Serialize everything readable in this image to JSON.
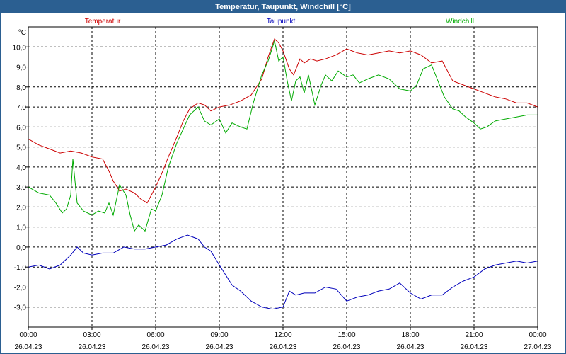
{
  "title": "Temperatur, Taupunkt, Windchill [°C]",
  "chart_data": {
    "type": "line",
    "title": "Temperatur, Taupunkt, Windchill [°C]",
    "ylabel": "°C",
    "ylim": [
      -4,
      11
    ],
    "xlim": [
      0,
      24
    ],
    "grid": true,
    "legend_placement": "top",
    "y_ticks": [
      {
        "value": 10,
        "label": "10,0"
      },
      {
        "value": 9,
        "label": "9,0"
      },
      {
        "value": 8,
        "label": "8,0"
      },
      {
        "value": 7,
        "label": "7,0"
      },
      {
        "value": 6,
        "label": "6,0"
      },
      {
        "value": 5,
        "label": "5,0"
      },
      {
        "value": 4,
        "label": "4,0"
      },
      {
        "value": 3,
        "label": "3,0"
      },
      {
        "value": 2,
        "label": "2,0"
      },
      {
        "value": 1,
        "label": "1,0"
      },
      {
        "value": 0,
        "label": "0,0"
      },
      {
        "value": -1,
        "label": "-1,0"
      },
      {
        "value": -2,
        "label": "-2,0"
      },
      {
        "value": -3,
        "label": "-3,0"
      }
    ],
    "x_ticks": [
      {
        "value": 0,
        "time": "00:00",
        "date": "26.04.23"
      },
      {
        "value": 3,
        "time": "03:00",
        "date": "26.04.23"
      },
      {
        "value": 6,
        "time": "06:00",
        "date": "26.04.23"
      },
      {
        "value": 9,
        "time": "09:00",
        "date": "26.04.23"
      },
      {
        "value": 12,
        "time": "12:00",
        "date": "26.04.23"
      },
      {
        "value": 15,
        "time": "15:00",
        "date": "26.04.23"
      },
      {
        "value": 18,
        "time": "18:00",
        "date": "26.04.23"
      },
      {
        "value": 21,
        "time": "21:00",
        "date": "26.04.23"
      },
      {
        "value": 24,
        "time": "00:00",
        "date": "27.04.23"
      }
    ],
    "series": [
      {
        "name": "Temperatur",
        "color": "#cc0000",
        "x": [
          0,
          0.5,
          1,
          1.5,
          2,
          2.5,
          3,
          3.5,
          3.8,
          4,
          4.3,
          4.6,
          5,
          5.3,
          5.6,
          6,
          6.3,
          6.6,
          7,
          7.3,
          7.6,
          8,
          8.3,
          8.6,
          9,
          9.5,
          10,
          10.5,
          11,
          11.3,
          11.6,
          11.8,
          12,
          12.3,
          12.5,
          12.8,
          13,
          13.3,
          13.6,
          14,
          14.5,
          15,
          15.5,
          16,
          16.5,
          17,
          17.5,
          18,
          18.5,
          19,
          19.5,
          20,
          20.5,
          21,
          21.5,
          22,
          22.5,
          23,
          23.5,
          24
        ],
        "values": [
          5.4,
          5.1,
          4.9,
          4.7,
          4.8,
          4.7,
          4.5,
          4.4,
          3.8,
          3.3,
          2.8,
          2.9,
          2.7,
          2.4,
          2.2,
          3,
          3.7,
          4.5,
          5.5,
          6.3,
          6.9,
          7.2,
          7.1,
          6.8,
          7,
          7.1,
          7.3,
          7.6,
          8.4,
          9.5,
          10.4,
          10.2,
          9.8,
          8.9,
          8.6,
          9.4,
          9.2,
          9.4,
          9.3,
          9.4,
          9.6,
          9.9,
          9.7,
          9.6,
          9.7,
          9.8,
          9.7,
          9.8,
          9.6,
          9.2,
          9.3,
          8.3,
          8.1,
          7.9,
          7.7,
          7.5,
          7.4,
          7.2,
          7.2,
          7
        ]
      },
      {
        "name": "Taupunkt",
        "color": "#0000bb",
        "x": [
          0,
          0.5,
          1,
          1.5,
          2,
          2.3,
          2.6,
          3,
          3.5,
          4,
          4.5,
          5,
          5.5,
          6,
          6.5,
          7,
          7.5,
          8,
          8.3,
          8.6,
          9,
          9.3,
          9.6,
          10,
          10.5,
          11,
          11.5,
          12,
          12.3,
          12.6,
          13,
          13.5,
          14,
          14.5,
          15,
          15.5,
          16,
          16.5,
          17,
          17.5,
          18,
          18.5,
          19,
          19.5,
          20,
          20.5,
          21,
          21.5,
          22,
          22.5,
          23,
          23.5,
          24
        ],
        "values": [
          -1,
          -0.9,
          -1.1,
          -0.9,
          -0.4,
          0,
          -0.3,
          -0.4,
          -0.3,
          -0.3,
          0,
          -0.1,
          -0.1,
          0,
          0.1,
          0.4,
          0.6,
          0.4,
          0,
          -0.2,
          -0.9,
          -1.4,
          -1.9,
          -2.2,
          -2.7,
          -3,
          -3.1,
          -3,
          -2.2,
          -2.4,
          -2.3,
          -2.3,
          -2,
          -2.1,
          -2.7,
          -2.5,
          -2.4,
          -2.2,
          -2.1,
          -1.8,
          -2.3,
          -2.6,
          -2.4,
          -2.4,
          -2,
          -1.7,
          -1.5,
          -1.1,
          -0.9,
          -0.8,
          -0.7,
          -0.8,
          -0.7
        ]
      },
      {
        "name": "Windchill",
        "color": "#00aa00",
        "x": [
          0,
          0.5,
          1,
          1.3,
          1.6,
          1.8,
          2,
          2.1,
          2.3,
          2.6,
          3,
          3.3,
          3.6,
          3.8,
          4,
          4.3,
          4.6,
          4.8,
          5,
          5.2,
          5.5,
          5.8,
          6,
          6.3,
          6.6,
          7,
          7.3,
          7.6,
          8,
          8.3,
          8.6,
          9,
          9.3,
          9.6,
          10,
          10.3,
          10.6,
          11,
          11.3,
          11.6,
          11.8,
          12,
          12.2,
          12.4,
          12.6,
          12.8,
          13,
          13.2,
          13.5,
          13.8,
          14,
          14.3,
          14.6,
          15,
          15.3,
          15.6,
          16,
          16.5,
          17,
          17.5,
          18,
          18.3,
          18.6,
          19,
          19.3,
          19.6,
          20,
          20.3,
          20.6,
          21,
          21.3,
          21.6,
          22,
          22.5,
          23,
          23.5,
          24
        ],
        "values": [
          3,
          2.7,
          2.6,
          2.2,
          1.7,
          1.9,
          2.6,
          4.4,
          2.2,
          1.8,
          1.6,
          1.8,
          1.7,
          2.2,
          1.6,
          3.1,
          2.6,
          1.6,
          0.8,
          1.1,
          0.8,
          1.9,
          1.8,
          2.6,
          4,
          5.2,
          5.9,
          6.6,
          7,
          6.3,
          6.1,
          6.4,
          5.7,
          6.2,
          6,
          5.9,
          7.2,
          8.6,
          9.3,
          10.3,
          9.3,
          9.5,
          8.3,
          7.3,
          8.3,
          8.5,
          7.7,
          8.6,
          7.1,
          8.1,
          8.6,
          8.3,
          8.8,
          8.5,
          8.6,
          8.2,
          8.4,
          8.6,
          8.4,
          7.9,
          7.8,
          8.1,
          8.9,
          9.1,
          8.3,
          7.5,
          6.9,
          6.8,
          6.5,
          6.2,
          5.9,
          6,
          6.3,
          6.4,
          6.5,
          6.6,
          6.6
        ]
      }
    ]
  }
}
